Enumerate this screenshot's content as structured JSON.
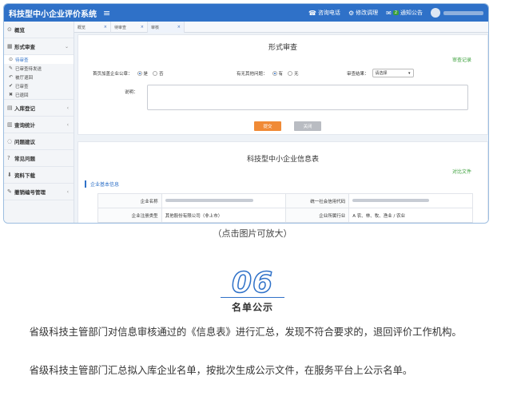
{
  "app": {
    "title": "科技型中小企业评价系统",
    "menu_icon": "≡",
    "top_items": [
      {
        "icon": "☎",
        "label": "咨询电话"
      },
      {
        "icon": "⚙",
        "label": "修改调理"
      },
      {
        "icon": "✉",
        "label": "通知公告"
      }
    ],
    "notice_badge": "2"
  },
  "sidebar": {
    "items": [
      {
        "icon": "⊙",
        "label": "概览",
        "arrow": ""
      },
      {
        "icon": "▦",
        "label": "形式审查",
        "arrow": "⌄"
      }
    ],
    "subitems": [
      {
        "icon": "⊙",
        "label": "待审查"
      },
      {
        "icon": "✎",
        "label": "已审查待发送"
      },
      {
        "icon": "↶",
        "label": "被厅退回"
      },
      {
        "icon": "✔",
        "label": "已审查"
      },
      {
        "icon": "✖",
        "label": "已退回"
      }
    ],
    "items2": [
      {
        "icon": "▤",
        "label": "入库登记",
        "arrow": "‹"
      },
      {
        "icon": "▥",
        "label": "查询统计",
        "arrow": "‹"
      },
      {
        "icon": "◌",
        "label": "问题建议",
        "arrow": ""
      },
      {
        "icon": "?",
        "label": "常见问题",
        "arrow": ""
      },
      {
        "icon": "⬇",
        "label": "资料下载",
        "arrow": ""
      },
      {
        "icon": "✎",
        "label": "撤销编号管理",
        "arrow": "‹"
      }
    ]
  },
  "tabs": [
    {
      "label": "概览",
      "close": "×"
    },
    {
      "label": "待审查",
      "close": "×"
    },
    {
      "label": "审核",
      "close": "×"
    }
  ],
  "review": {
    "title": "形式审查",
    "record_link": "审查记录",
    "q1_label": "首页加盖企业公章：",
    "q1_yes": "是",
    "q1_no": "否",
    "q2_label": "有无其他问题：",
    "q2_yes": "有",
    "q2_no": "无",
    "result_label": "审查结果：",
    "result_placeholder": "请选择",
    "remark_label": "说明：",
    "submit": "提交",
    "back": "关闭"
  },
  "info": {
    "title": "科技型中小企业信息表",
    "compare_link": "对比文件",
    "section": "企业基本信息",
    "rows": [
      {
        "k1": "企业名称",
        "v1": "",
        "k2": "统一社会信用代码",
        "v2": ""
      },
      {
        "k1": "企业注册类型",
        "v1": "其他股份有限公司（非上市）",
        "k2": "企业所属行业",
        "v2": "A 农、林、牧、渔业 / 农业"
      }
    ]
  },
  "page": {
    "caption": "（点击图片可放大）",
    "step_number": "06",
    "step_title": "名单公示",
    "p1": "省级科技主管部门对信息审核通过的《信息表》进行汇总，发现不符合要求的，退回评价工作机构。",
    "p2": "省级科技主管部门汇总拟入库企业名单，按批次生成公示文件，在服务平台上公示名单。"
  },
  "colors": {
    "brand": "#2f71c8",
    "link_green": "#3ba03b",
    "submit": "#f08a36",
    "back": "#b9bcc2"
  }
}
